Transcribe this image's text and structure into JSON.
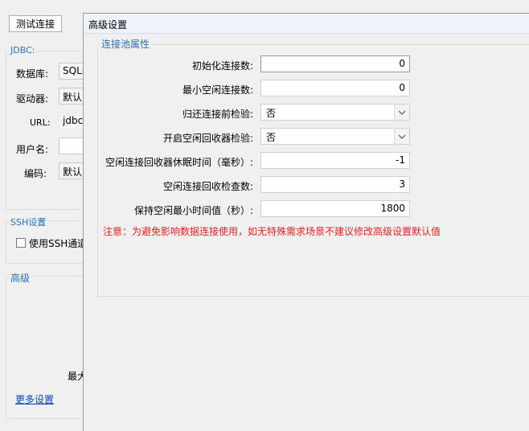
{
  "background": {
    "test_button": "测试连接",
    "jdbc_group": "JDBC:",
    "labels": {
      "database": "数据库:",
      "driver": "驱动器:",
      "url": "URL:",
      "username": "用户名:",
      "encoding": "编码:"
    },
    "values": {
      "database": "SQLi",
      "driver": "默认",
      "url": "jdbc:",
      "username": "",
      "encoding": "默认"
    },
    "ssh_group": "SSH设置",
    "ssh_checkbox": "使用SSH通道",
    "advanced_group": "高级",
    "truncated_label": "最大",
    "more_settings": "更多设置"
  },
  "dialog": {
    "title": "高级设置",
    "group_title": "连接池属性",
    "rows": [
      {
        "label": "初始化连接数:",
        "type": "number",
        "value": "0"
      },
      {
        "label": "最小空闲连接数:",
        "type": "number",
        "value": "0"
      },
      {
        "label": "归还连接前检验:",
        "type": "select",
        "value": "否"
      },
      {
        "label": "开启空闲回收器检验:",
        "type": "select",
        "value": "否"
      },
      {
        "label": "空闲连接回收器休眠时间（毫秒）:",
        "type": "number",
        "value": "-1"
      },
      {
        "label": "空闲连接回收检查数:",
        "type": "number",
        "value": "3"
      },
      {
        "label": "保持空闲最小时间值（秒）:",
        "type": "number",
        "value": "1800"
      }
    ],
    "notice": "注意：为避免影响数据连接使用，如无特殊需求场景不建议修改高级设置默认值"
  },
  "colors": {
    "group_title": "#2b6fb6",
    "notice": "#e02020",
    "link": "#0645ad"
  }
}
